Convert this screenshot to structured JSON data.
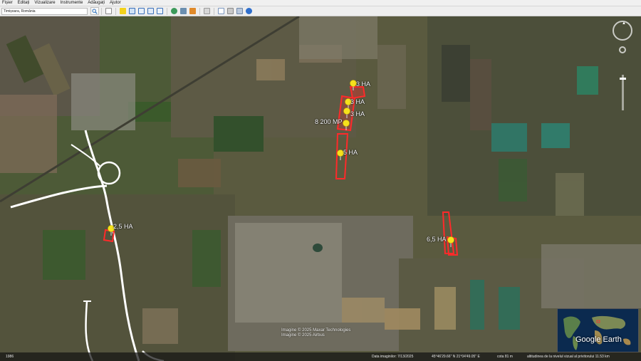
{
  "menu": [
    "Fișier",
    "Editați",
    "Vizualizare",
    "Instrumente",
    "Adăugați",
    "Ajutor"
  ],
  "search": {
    "value": "Timișoara, România"
  },
  "toolbar_icons": [
    "search-icon",
    "hide-sidebar-icon",
    "placemark-icon",
    "polygon-icon",
    "path-icon",
    "image-overlay-icon",
    "record-tour-icon",
    "historical-imagery-icon",
    "sunlight-icon",
    "planets-icon",
    "ruler-icon",
    "email-icon",
    "print-icon",
    "save-image-icon",
    "google-maps-icon"
  ],
  "placemarks": [
    {
      "label": "3 HA"
    },
    {
      "label": "3 HA"
    },
    {
      "label": "3 HA"
    },
    {
      "label": "8 200 MP"
    },
    {
      "label": "5 HA"
    },
    {
      "label": "2,5 HA"
    },
    {
      "label": "6,5 HA"
    }
  ],
  "copyright": [
    "Imagine © 2025 Maxar Technologies",
    "Imagine © 2025 Airbus"
  ],
  "logo": "Google Earth",
  "status": {
    "scale": "1986",
    "imagery_date": "Data imaginilor: 7/13/2025",
    "coords": "45°46'29.66\" N  21°04'49.05\" E",
    "elevation": "cota  81 m",
    "eye_alt": "altitudinea de la nivelul vizual al privitorului  11.53 km"
  },
  "colors": {
    "highlight": "#ff2a2a",
    "pin": "#f5e11c",
    "road": "#ffffff"
  }
}
